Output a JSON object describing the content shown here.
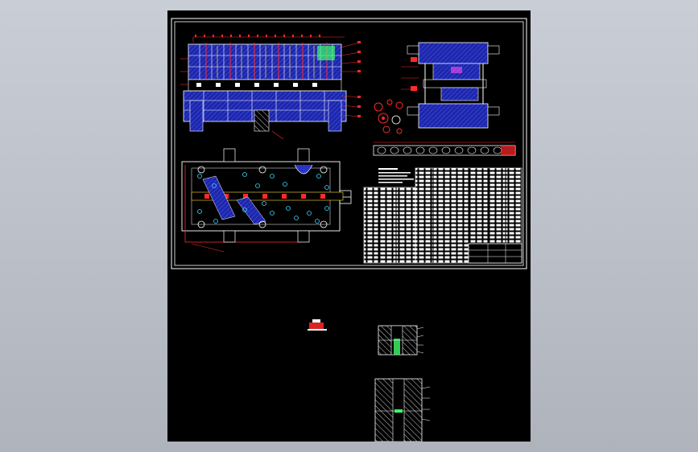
{
  "app": {
    "background_top": "#c9ced6",
    "background_bottom": "#aeb3bc"
  },
  "drawing": {
    "sheet_color": "#000000",
    "frame_color": "#ffffff",
    "colors": {
      "hatch_blue": "#2a34c8",
      "white": "#ffffff",
      "red": "#ff2a2a",
      "cyan": "#3ad7ff",
      "yellow": "#ffe23a",
      "magenta": "#ff4df0",
      "green": "#3cff6a"
    }
  }
}
